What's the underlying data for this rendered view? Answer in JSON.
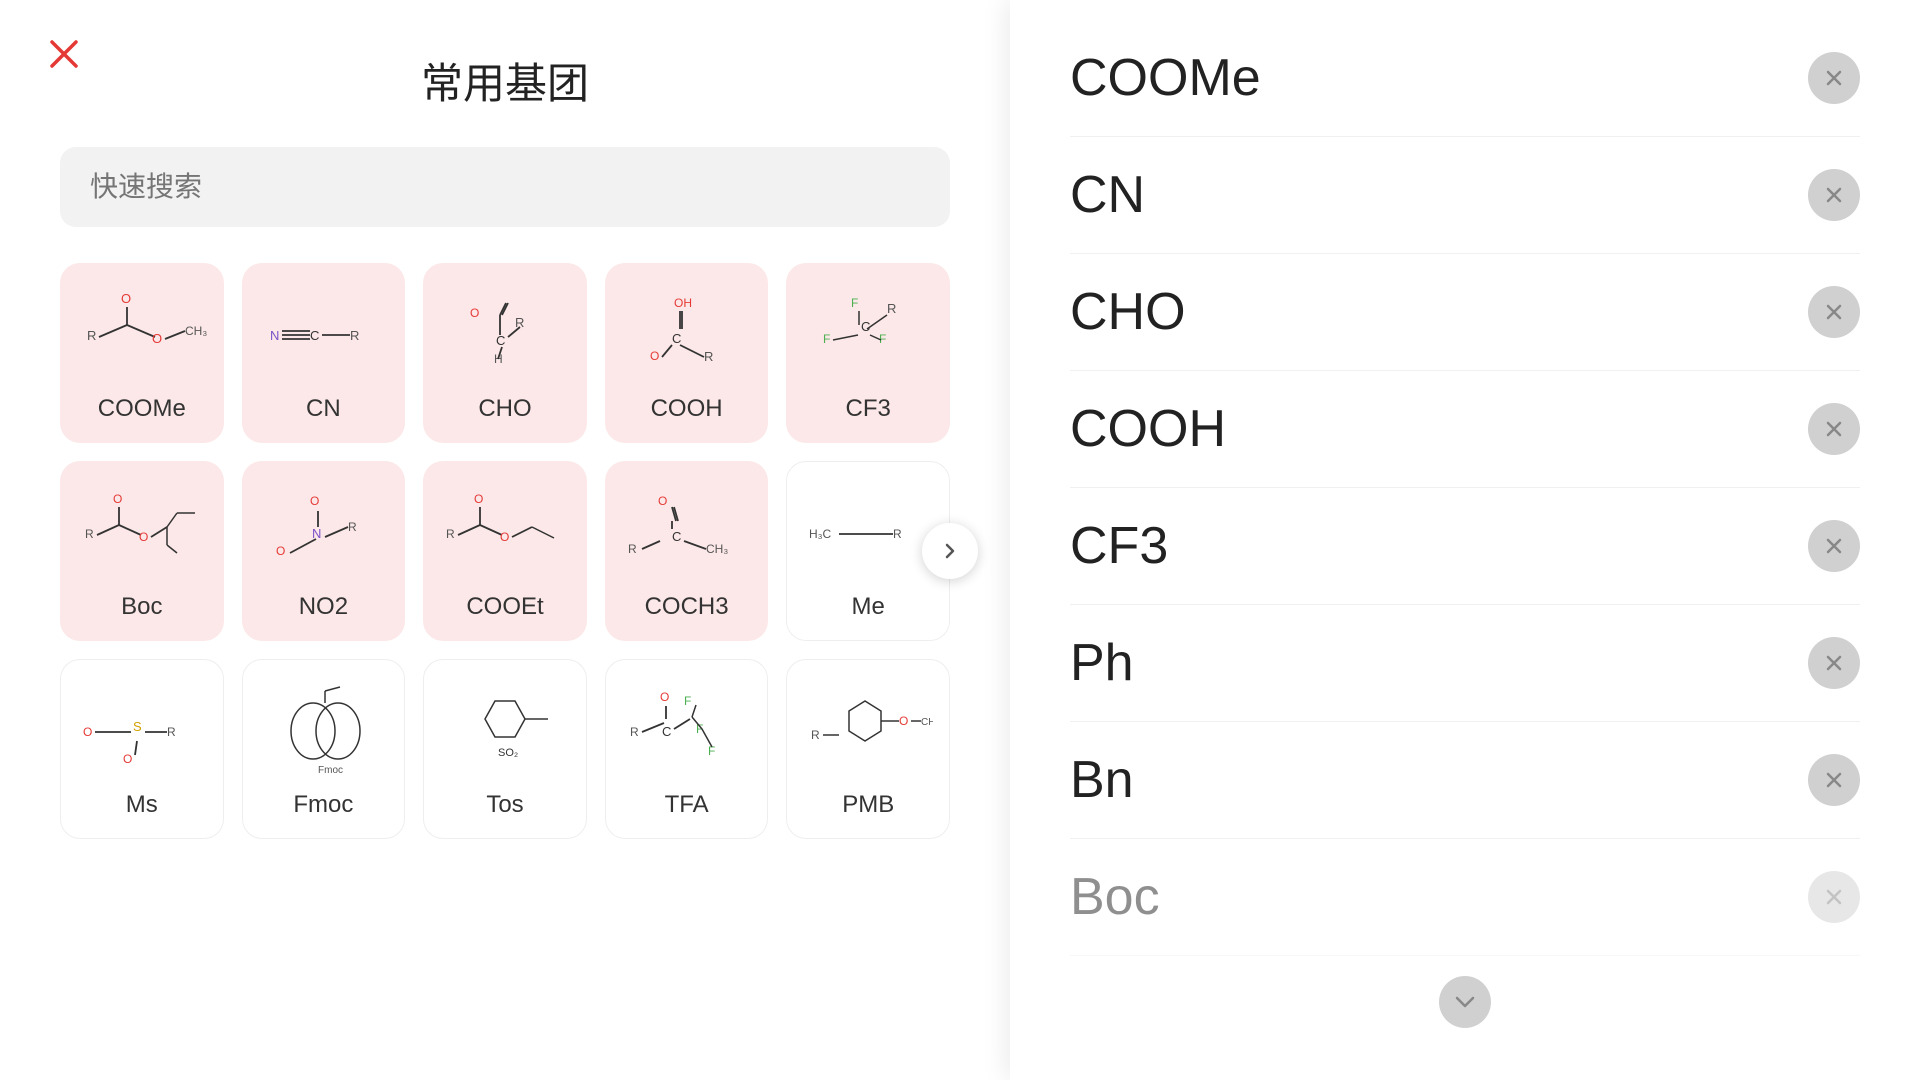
{
  "title": "常用基团",
  "search_placeholder": "快速搜索",
  "grid_items": [
    {
      "label": "COOMe",
      "bg": "pink"
    },
    {
      "label": "CN",
      "bg": "pink"
    },
    {
      "label": "CHO",
      "bg": "pink"
    },
    {
      "label": "COOH",
      "bg": "pink"
    },
    {
      "label": "CF3",
      "bg": "pink"
    },
    {
      "label": "Boc",
      "bg": "pink"
    },
    {
      "label": "NO2",
      "bg": "pink"
    },
    {
      "label": "COOEt",
      "bg": "pink"
    },
    {
      "label": "COCH3",
      "bg": "pink"
    },
    {
      "label": "Me",
      "bg": "white"
    },
    {
      "label": "Ms",
      "bg": "white"
    },
    {
      "label": "Fmoc",
      "bg": "white"
    },
    {
      "label": "Tos",
      "bg": "white"
    },
    {
      "label": "TFA",
      "bg": "white"
    },
    {
      "label": "PMB",
      "bg": "white"
    }
  ],
  "right_items": [
    {
      "label": "COOMe"
    },
    {
      "label": "CN"
    },
    {
      "label": "CHO"
    },
    {
      "label": "COOH"
    },
    {
      "label": "CF3"
    },
    {
      "label": "Ph"
    },
    {
      "label": "Bn"
    },
    {
      "label": "Boc"
    }
  ],
  "next_btn_label": "›",
  "scroll_down_label": "›"
}
